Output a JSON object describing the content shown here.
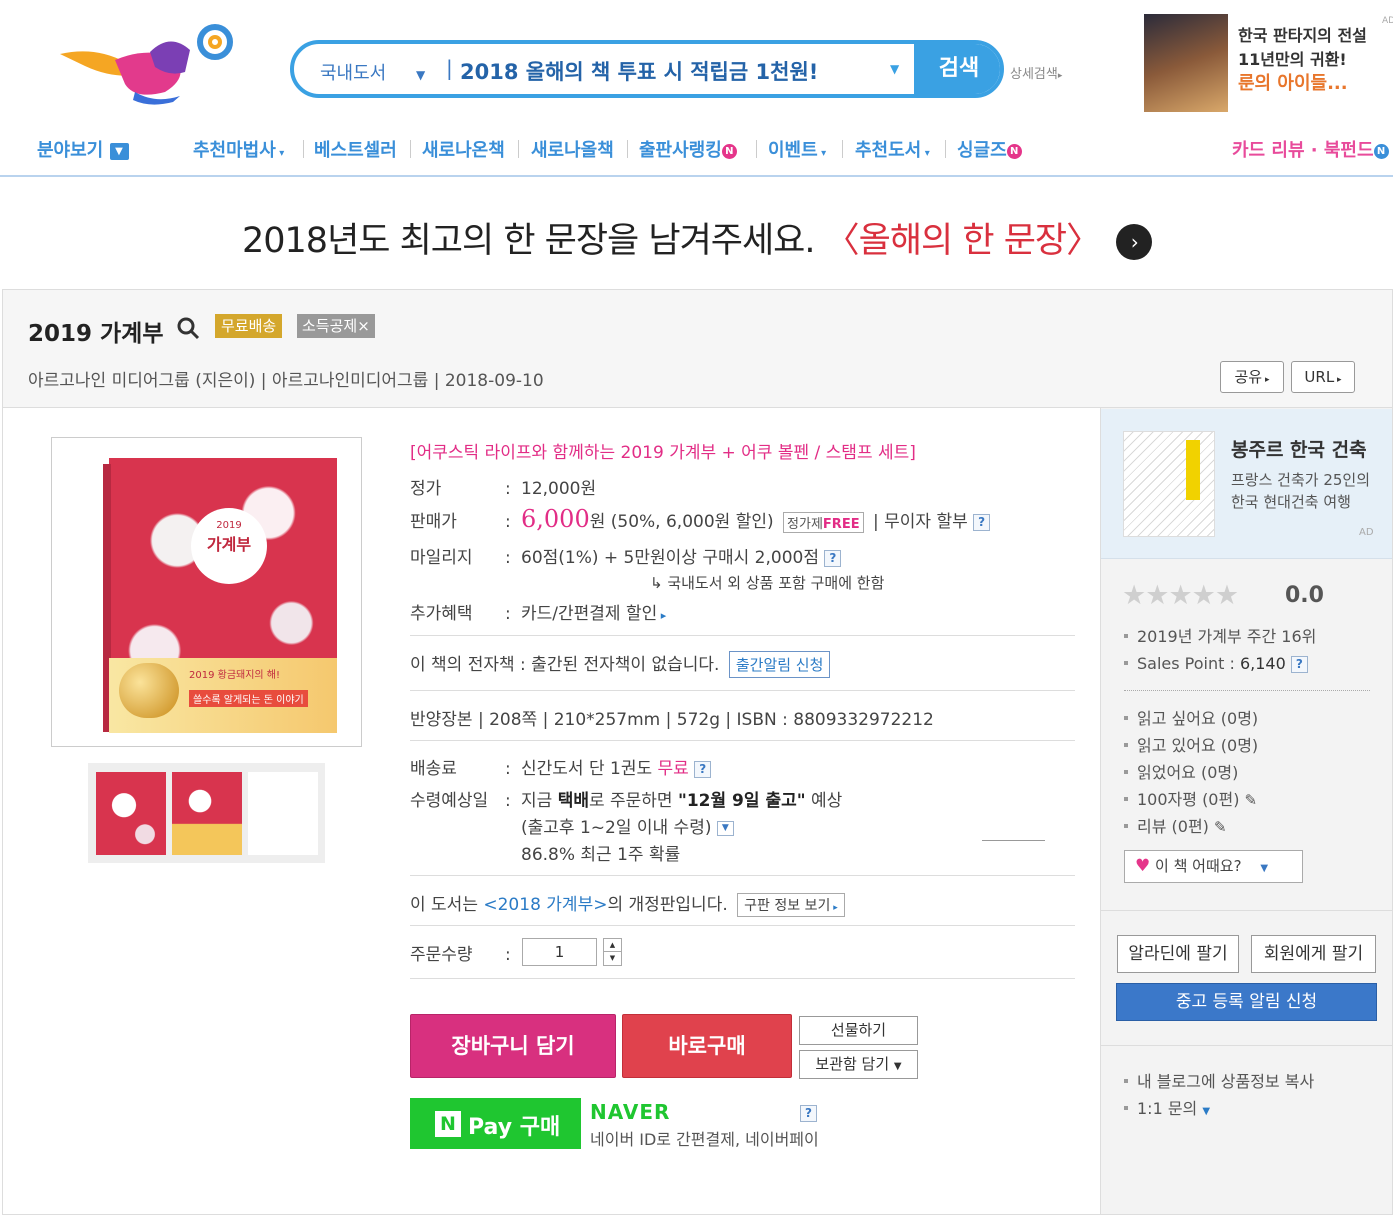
{
  "header": {
    "search": {
      "category": "국내도서",
      "query": "2018 올해의 책 투표 시 적립금 1천원!",
      "button": "검색",
      "advanced": "상세검색"
    },
    "ad": {
      "line1": "한국 판타지의 전설",
      "line2": "11년만의 귀환!",
      "line3": "룬의 아이들...",
      "tag": "AD"
    }
  },
  "nav": {
    "browse": "분야보기",
    "items": [
      "추천마법사",
      "베스트셀러",
      "새로나온책",
      "새로나올책",
      "출판사랭킹",
      "이벤트",
      "추천도서",
      "싱글즈"
    ],
    "right": "카드 리뷰 · 북펀드",
    "badge": "N"
  },
  "banner": {
    "text": "2018년도 최고의 한 문장을 남겨주세요.",
    "highlight": "〈올해의 한 문장〉"
  },
  "product": {
    "title": "2019 가계부",
    "badge_free": "무료배송",
    "badge_tax": "소득공제",
    "meta": "아르고나인 미디어그룹 (지은이) | 아르고나인미디어그룹 | 2018-09-10",
    "share": "공유",
    "url": "URL",
    "subtitle": "[어쿠스틱 라이프와 함께하는 2019 가계부 + 어쿠 볼펜 / 스탬프 세트]",
    "price_label": "정가",
    "price": "12,000원",
    "sale_label": "판매가",
    "sale_price": "6,000",
    "sale_unit": "원",
    "sale_discount": "(50%, 6,000원 할인)",
    "flat_price": "정가제",
    "flat_free": "FREE",
    "installment": "| 무이자 할부",
    "mileage_label": "마일리지",
    "mileage": "60점(1%) + 5만원이상 구매시 2,000점",
    "mileage_note": "↳ 국내도서 외 상품 포함 구매에 한함",
    "benefit_label": "추가혜택",
    "benefit": "카드/간편결제 할인",
    "ebook": "이 책의 전자책 : 출간된 전자책이 없습니다.",
    "ebook_button": "출간알림 신청",
    "specs": "반양장본 | 208쪽 | 210*257mm | 572g | ISBN : 8809332972212",
    "shipping_label": "배송료",
    "shipping": "신간도서 단 1권도",
    "shipping_free": "무료",
    "delivery_label": "수령예상일",
    "delivery_pre": "지금",
    "delivery_method": "택배",
    "delivery_mid": "로 주문하면",
    "delivery_date": "\"12월 9일 출고\"",
    "delivery_post": "예상",
    "delivery_note": "(출고후 1~2일 이내 수령)",
    "delivery_prob": "86.8% 최근 1주 확률",
    "edition_pre": "이 도서는",
    "edition_link": "<2018 가계부>",
    "edition_post": "의 개정판입니다.",
    "edition_button": "구판 정보 보기",
    "qty_label": "주문수량",
    "qty": "1",
    "cart": "장바구니 담기",
    "buy": "바로구매",
    "gift": "선물하기",
    "wishlist": "보관함 담기",
    "npay_n": "N",
    "npay": "Pay 구매",
    "naver": "NAVER",
    "naver_note": "네이버 ID로 간편결제, 네이버페이",
    "cover_title": "2019",
    "cover_title2": "가계부",
    "cover_band": "2019 황금돼지의 해!",
    "cover_band2": "쓸수록 알게되는 돈 이야기"
  },
  "sidebar": {
    "ad_title": "봉주르 한국 건축",
    "ad_sub1": "프랑스 건축가 25인의",
    "ad_sub2": "한국 현대건축 여행",
    "ad_tag": "AD",
    "rating": "0.0",
    "rank": "2019년 가계부 주간 16위",
    "sales_label": "Sales Point :",
    "sales": "6,140",
    "reading": [
      "읽고 싶어요 (0명)",
      "읽고 있어요 (0명)",
      "읽었어요 (0명)",
      "100자평 (0편)",
      "리뷰 (0편)"
    ],
    "howabout": "이 책 어때요?",
    "sell_aladin": "알라딘에 팔기",
    "sell_member": "회원에게 팔기",
    "used_alert": "중고 등록 알림 신청",
    "blog": "내 블로그에 상품정보 복사",
    "inquiry": "1:1 문의"
  },
  "colors": {
    "accent_blue": "#3a8fd9",
    "pink": "#e22d86",
    "cart_button": "#d8307f",
    "buy_button": "#e0424d",
    "npay_green": "#1fc630"
  }
}
